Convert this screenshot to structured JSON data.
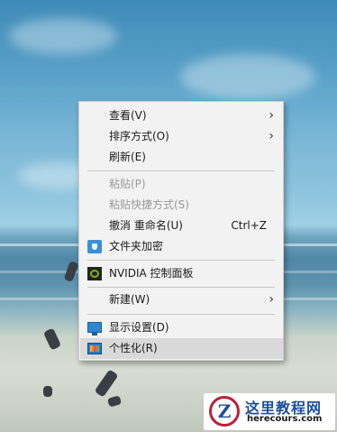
{
  "context_menu": {
    "items": [
      {
        "label": "查看(V)",
        "submenu": true,
        "disabled": false
      },
      {
        "label": "排序方式(O)",
        "submenu": true,
        "disabled": false
      },
      {
        "label": "刷新(E)",
        "submenu": false,
        "disabled": false
      },
      {
        "label": "粘贴(P)",
        "submenu": false,
        "disabled": true
      },
      {
        "label": "粘贴快捷方式(S)",
        "submenu": false,
        "disabled": true
      },
      {
        "label": "撤消 重命名(U)",
        "shortcut": "Ctrl+Z",
        "submenu": false,
        "disabled": false
      },
      {
        "label": "文件夹加密",
        "icon": "folder-shield-icon",
        "submenu": false,
        "disabled": false
      },
      {
        "label": "NVIDIA 控制面板",
        "icon": "nvidia-icon",
        "submenu": false,
        "disabled": false
      },
      {
        "label": "新建(W)",
        "submenu": true,
        "disabled": false
      },
      {
        "label": "显示设置(D)",
        "icon": "display-icon",
        "submenu": false,
        "disabled": false
      },
      {
        "label": "个性化(R)",
        "icon": "personalize-icon",
        "submenu": false,
        "disabled": false,
        "highlighted": true
      }
    ],
    "submenu_arrow": "›"
  },
  "watermark": {
    "logo_letter": "Z",
    "title": "这里教程网",
    "url": "herecours.com"
  },
  "colors": {
    "menu_bg": "#f2f2f2",
    "highlight": "#d9d9d9",
    "disabled_text": "#9a9a9a",
    "watermark_red": "#b8213a",
    "watermark_blue": "#1d4f9c"
  }
}
